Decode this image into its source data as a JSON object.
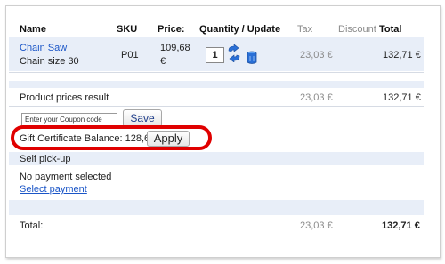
{
  "table": {
    "headers": {
      "name": "Name",
      "sku": "SKU",
      "price": "Price:",
      "quantity": "Quantity / Update",
      "tax": "Tax",
      "discount": "Discount",
      "total": "Total"
    },
    "product": {
      "name": "Chain Saw",
      "variant": "Chain size 30",
      "sku": "P01",
      "price_amount": "109,68",
      "price_currency": "€",
      "quantity": "1",
      "tax": "23,03 €",
      "total": "132,71 €"
    },
    "product_result": {
      "label": "Product prices result",
      "tax": "23,03 €",
      "total": "132,71 €"
    }
  },
  "coupon": {
    "placeholder": "Enter your Coupon code",
    "save_label": "Save"
  },
  "gift": {
    "label": "Gift Certificate Balance: 128,66 €",
    "apply_label": "Apply"
  },
  "shipping": {
    "label": "Self pick-up"
  },
  "payment": {
    "status": "No payment selected",
    "select_link": "Select payment"
  },
  "totals": {
    "label": "Total:",
    "tax": "23,03 €",
    "total": "132,71 €"
  },
  "colors": {
    "accent_link": "#1a55c7",
    "highlight": "#e00000",
    "band": "#e8eef8"
  },
  "icons": {
    "update": "refresh-arrows-icon",
    "delete": "trash-can-icon"
  }
}
